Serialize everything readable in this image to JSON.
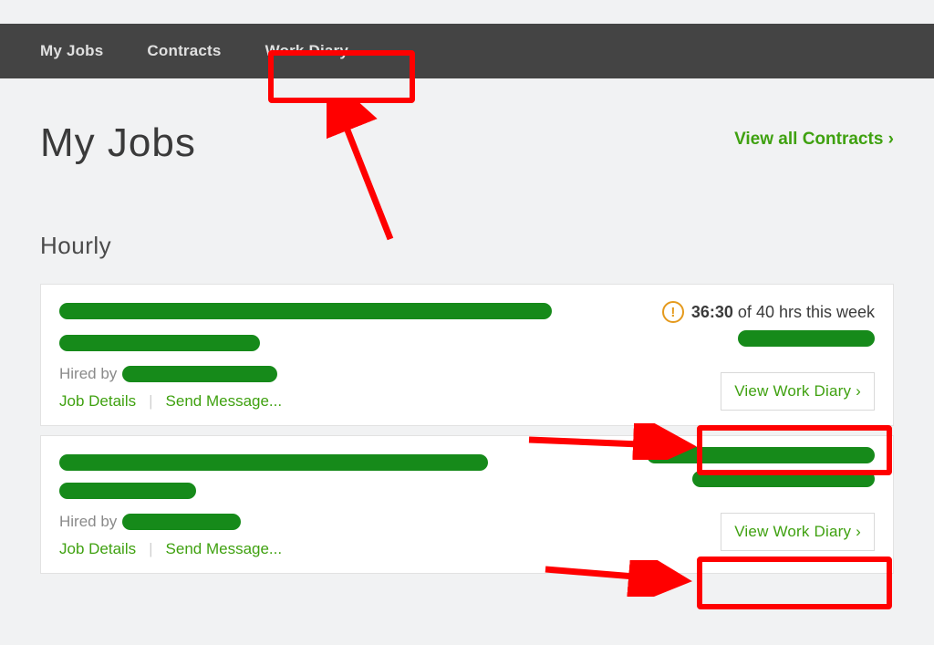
{
  "nav": {
    "myJobs": "My Jobs",
    "contracts": "Contracts",
    "workDiary": "Work Diary"
  },
  "page": {
    "title": "My Jobs",
    "viewAll": "View all Contracts ›",
    "section": "Hourly"
  },
  "hours": {
    "used": "36:30",
    "middle": " of ",
    "cap": "40 hrs this week"
  },
  "labels": {
    "hiredBy": "Hired by",
    "jobDetails": "Job Details",
    "sendMessage": "Send Message...",
    "viewWorkDiary": "View Work Diary ›",
    "warn": "!"
  }
}
